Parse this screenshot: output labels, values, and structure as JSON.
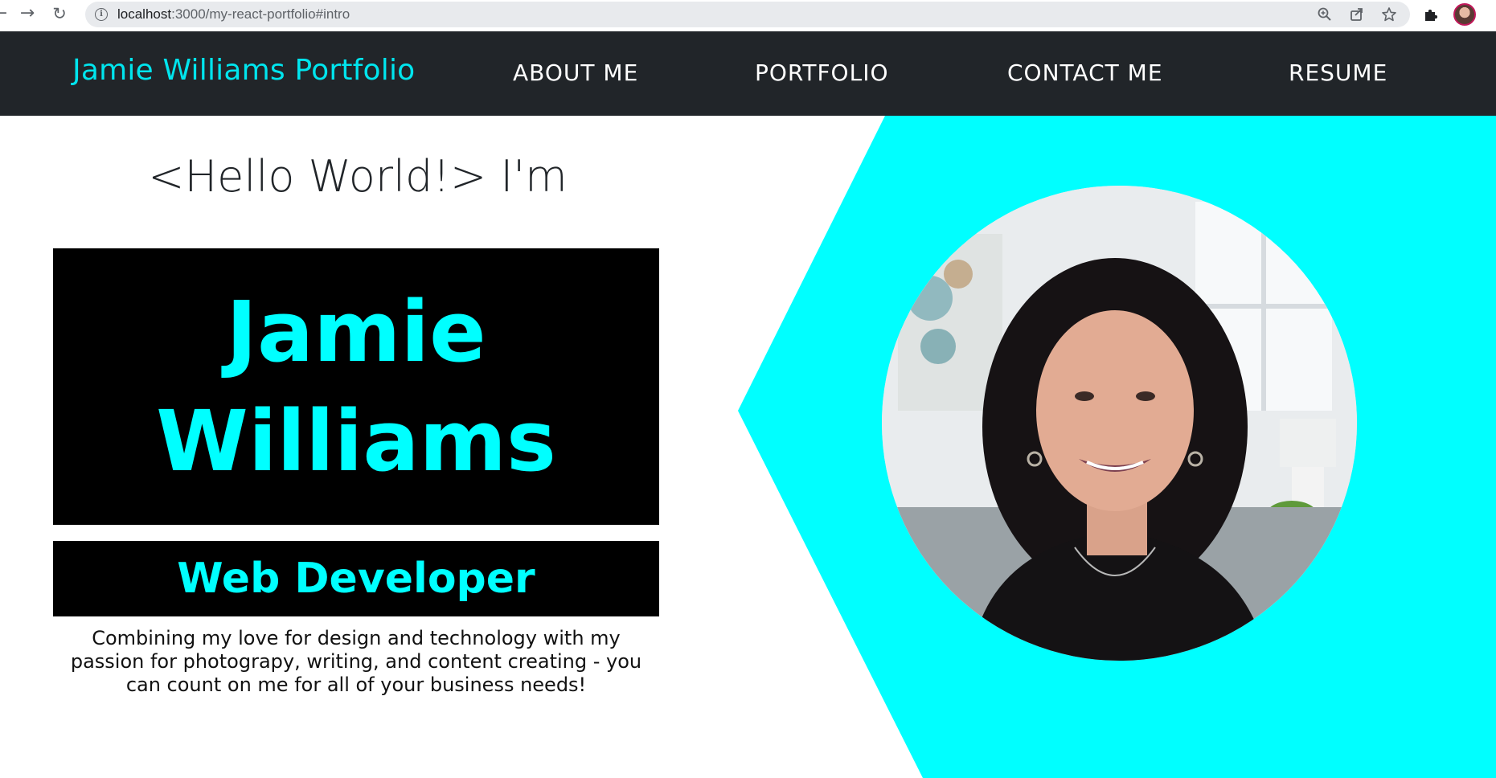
{
  "browser": {
    "url_host": "localhost",
    "url_path": ":3000/my-react-portfolio#intro"
  },
  "navbar": {
    "brand": "Jamie Williams Portfolio",
    "links": [
      "ABOUT ME",
      "PORTFOLIO",
      "CONTACT ME",
      "RESUME"
    ]
  },
  "hero": {
    "greeting": "<Hello World!> I'm",
    "first_name": "Jamie",
    "last_name": "Williams",
    "role": "Web Developer",
    "tagline_lines": [
      "Combining my love for design and technology with my",
      "passion for photograpy, writing, and content creating - you",
      "can count on me for all of your business needs!"
    ]
  },
  "colors": {
    "accent": "#00ffff",
    "navbar_bg": "#212529",
    "box_bg": "#000000"
  }
}
